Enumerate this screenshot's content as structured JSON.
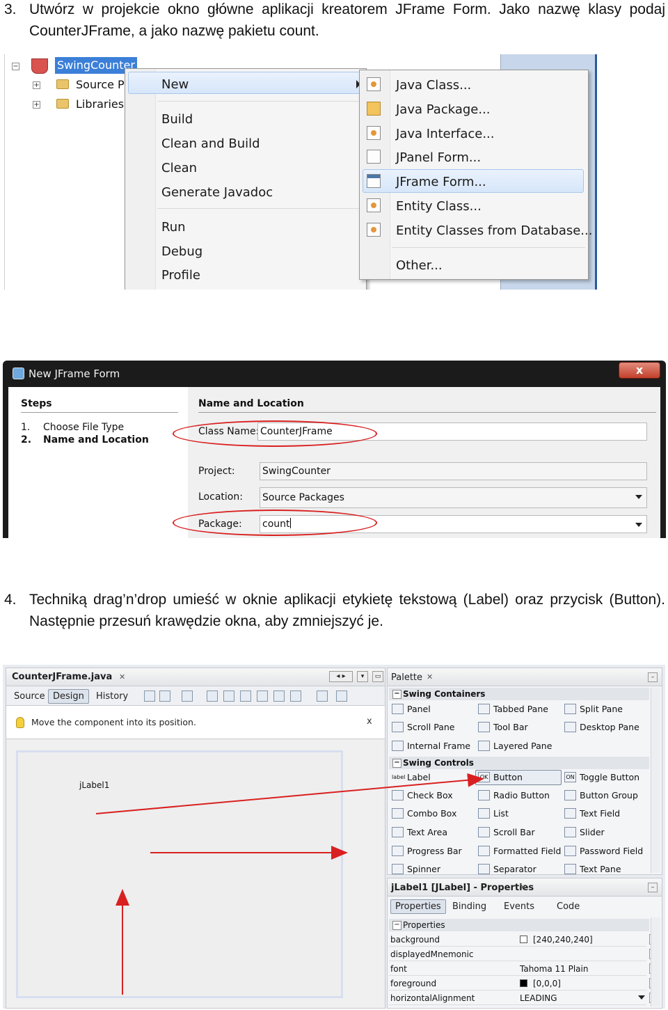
{
  "step3": {
    "number": "3.",
    "text": "Utwórz w projekcie okno główne aplikacji kreatorem JFrame Form. Jako nazwę klasy podaj CounterJFrame, a jako nazwę pakietu count."
  },
  "step4": {
    "number": "4.",
    "text": "Techniką drag’n’drop umieść w oknie aplikacji etykietę tekstową (Label) oraz przycisk (Button). Następnie przesuń krawędzie okna, aby zmniejszyć je."
  },
  "shot1": {
    "tree": {
      "project": "SwingCounter",
      "source": "Source Pa",
      "libraries": "Libraries"
    },
    "context_menu": [
      "New",
      "Build",
      "Clean and Build",
      "Clean",
      "Generate Javadoc",
      "Run",
      "Debug",
      "Profile"
    ],
    "submenu": [
      "Java Class...",
      "Java Package...",
      "Java Interface...",
      "JPanel Form...",
      "JFrame Form...",
      "Entity Class...",
      "Entity Classes from Database...",
      "Other..."
    ],
    "highlighted_submenu_item": "JFrame Form..."
  },
  "shot2": {
    "title": "New JFrame Form",
    "close_label": "x",
    "steps_heading": "Steps",
    "steps": [
      {
        "num": "1.",
        "label": "Choose File Type"
      },
      {
        "num": "2.",
        "label": "Name and Location"
      }
    ],
    "section_heading": "Name and Location",
    "class_name_label": "Class Name:",
    "class_name_value": "CounterJFrame",
    "project_label": "Project:",
    "project_value": "SwingCounter",
    "location_label": "Location:",
    "location_value": "Source Packages",
    "package_label": "Package:",
    "package_value": "count"
  },
  "shot3": {
    "editor_tab": "CounterJFrame.java",
    "view_tabs": [
      "Source",
      "Design",
      "History"
    ],
    "active_view": "Design",
    "hint": "Move the component into its position.",
    "hint_close": "x",
    "form_label": "jLabel1",
    "palette": {
      "title": "Palette",
      "containers_heading": "Swing Containers",
      "containers": [
        "Panel",
        "Tabbed Pane",
        "Split Pane",
        "Scroll Pane",
        "Tool Bar",
        "Desktop Pane",
        "Internal Frame",
        "Layered Pane"
      ],
      "controls_heading": "Swing Controls",
      "controls": [
        "Label",
        "Button",
        "Toggle Button",
        "Check Box",
        "Radio Button",
        "Button Group",
        "Combo Box",
        "List",
        "Text Field",
        "Text Area",
        "Scroll Bar",
        "Slider",
        "Progress Bar",
        "Formatted Field",
        "Password Field",
        "Spinner",
        "Separator",
        "Text Pane"
      ],
      "label_icon_text": "label",
      "button_icon_text": "OK",
      "toggle_icon_text": "ON"
    },
    "properties": {
      "title": "jLabel1 [JLabel] - Properties",
      "tabs": [
        "Properties",
        "Binding",
        "Events",
        "Code"
      ],
      "section": "Properties",
      "rows": [
        {
          "name": "background",
          "value": "[240,240,240]",
          "swatch": "#ffffff"
        },
        {
          "name": "displayedMnemonic",
          "value": ""
        },
        {
          "name": "font",
          "value": "Tahoma 11 Plain"
        },
        {
          "name": "foreground",
          "value": "[0,0,0]",
          "swatch": "#000000"
        },
        {
          "name": "horizontalAlignment",
          "value": "LEADING"
        }
      ]
    },
    "arrow_color": "#d92020"
  }
}
